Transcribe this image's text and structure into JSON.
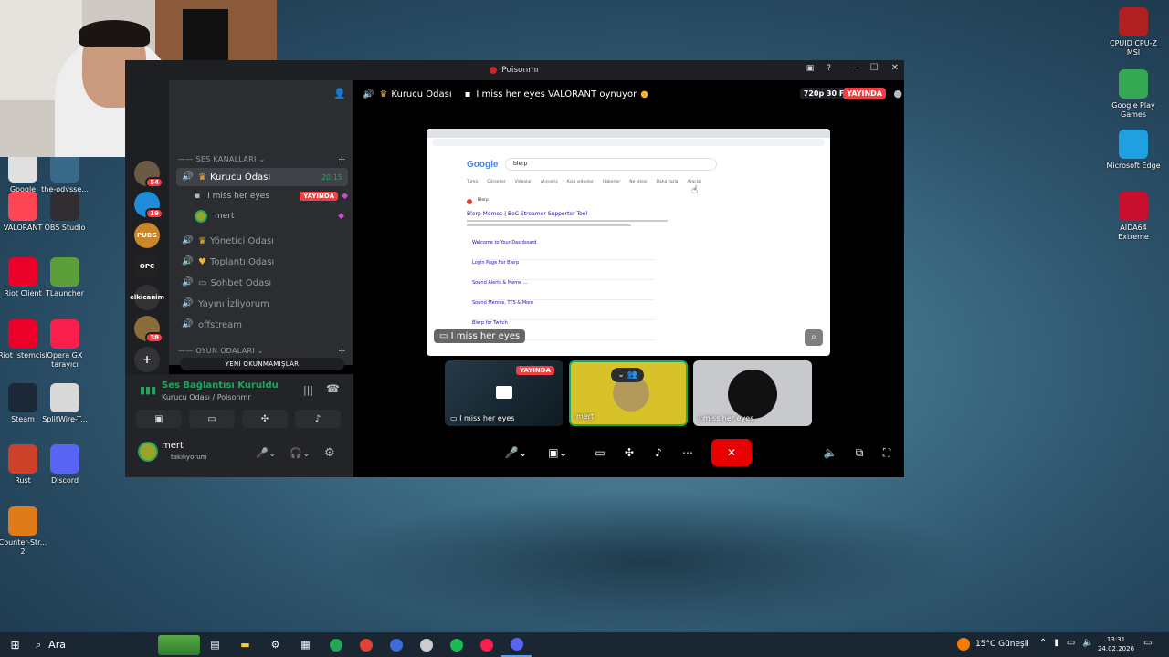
{
  "desktop": {
    "icons_left": [
      {
        "label": "Google Chrome",
        "color": "#e0e0e0"
      },
      {
        "label": "the-odysse...",
        "color": "#3a6a8a"
      },
      {
        "label": "VALORANT",
        "color": "#fd4556"
      },
      {
        "label": "OBS Studio",
        "color": "#302e31"
      },
      {
        "label": "Riot Client",
        "color": "#eb0029"
      },
      {
        "label": "TLauncher",
        "color": "#5b9e3a"
      },
      {
        "label": "Riot İstemcisi",
        "color": "#eb0029"
      },
      {
        "label": "Opera GX tarayıcı",
        "color": "#fa1e4e"
      },
      {
        "label": "Steam",
        "color": "#1b2838"
      },
      {
        "label": "SplitWire-T...",
        "color": "#d9d9d9"
      },
      {
        "label": "Rust",
        "color": "#cd412b"
      },
      {
        "label": "Discord",
        "color": "#5865f2"
      },
      {
        "label": "Counter-Str... 2",
        "color": "#e07b1a"
      }
    ],
    "icons_right": [
      {
        "label": "CPUID CPU-Z MSI",
        "color": "#b02020"
      },
      {
        "label": "Google Play Games",
        "color": "#34a853"
      },
      {
        "label": "Microsoft Edge",
        "color": "#1fa0e0"
      },
      {
        "label": "AIDA64 Extreme",
        "color": "#c8102e"
      }
    ]
  },
  "discord": {
    "window_title": "Poisonmr",
    "servers": [
      {
        "label": "",
        "badge": "54",
        "color": "#6b5b45"
      },
      {
        "label": "",
        "badge": "19",
        "color": "#1e8cd8"
      },
      {
        "label": "PUBG",
        "badge": "",
        "color": "#c9862b"
      },
      {
        "label": "OPC",
        "badge": "",
        "color": "#222"
      },
      {
        "label": "elkicanim",
        "badge": "",
        "color": "#333"
      },
      {
        "label": "",
        "badge": "38",
        "color": "#8a6d3b"
      }
    ],
    "categories": {
      "voice": "SES KANALLARI",
      "game": "OYUN ODALARI"
    },
    "channels": [
      {
        "name": "Kurucu Odası",
        "active": true,
        "time": "20:15"
      },
      {
        "name": "Yönetici Odası",
        "active": false
      },
      {
        "name": "Toplantı Odası",
        "active": false
      },
      {
        "name": "Sohbet Odası",
        "active": false
      },
      {
        "name": "Yayını İzliyorum",
        "active": false
      },
      {
        "name": "offstream",
        "active": false
      }
    ],
    "members": [
      {
        "name": "I miss her eyes",
        "live": "YAYINDA"
      },
      {
        "name": "mert",
        "live": ""
      }
    ],
    "unread_label": "YENİ OKUNMAMIŞLAR",
    "voice": {
      "status": "Ses Bağlantısı Kuruldu",
      "channel": "Kurucu Odası / Poisonmr"
    },
    "user": {
      "name": "mert",
      "status": "takılıyorum"
    },
    "stage": {
      "channel": "Kurucu Odası",
      "activity": "I miss her eyes VALORANT oynuyor",
      "fps": "720p 30 FPS",
      "live": "YAYINDA",
      "stream_label": "I miss her eyes",
      "tiles": [
        {
          "name": "I miss her eyes",
          "live": "YAYINDA"
        },
        {
          "name": "mert",
          "live": ""
        },
        {
          "name": "I miss her eyes",
          "live": ""
        }
      ]
    },
    "browser": {
      "logo": "Google",
      "query": "blerp",
      "tabs": [
        "Tümü",
        "Görseller",
        "Videolar",
        "Alışveriş",
        "Kısa videolar",
        "Haberler",
        "Ne sitesi",
        "Daha fazla",
        "Araçlar"
      ],
      "result_site": "Blerp",
      "result_title": "Blerp Memes | BeC Streamer Supporter Tool",
      "sublinks": [
        "Welcome to Your Dashboard",
        "Login Page For Blerp",
        "Sound Alerts & Meme ...",
        "Sound Memes, TTS & More",
        "Blerp for Twitch"
      ]
    }
  },
  "taskbar": {
    "search": "Ara",
    "weather": "15°C Güneşli",
    "time": "13:31",
    "date": "24.02.2026"
  }
}
